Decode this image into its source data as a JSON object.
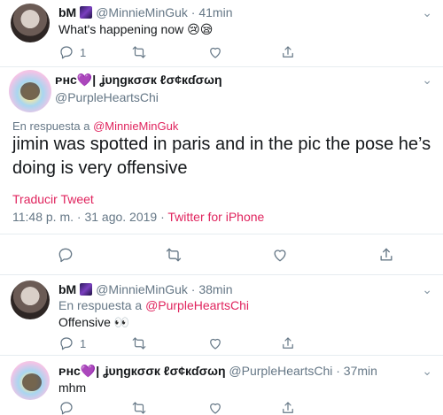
{
  "tweet1": {
    "name": "bM",
    "handle": "@MinnieMinGuk",
    "time": "· 41min",
    "text": "What's happening now 😢😪",
    "reply_count": "1",
    "retweet_count": "",
    "like_count": ""
  },
  "focused": {
    "name": "ᴘнc💜| ʝυηgкσσк ℓσ¢кɗσωη",
    "handle": "@PurpleHeartsChi",
    "replying_prefix": "En respuesta a ",
    "replying_to": "@MinnieMinGuk",
    "text": "jimin was spotted in paris and in the pic the pose he’s doing is very offensive",
    "translate": "Traducir Tweet",
    "timestamp": "11:48 p. m. · 31 ago. 2019",
    "separator": " · ",
    "source": "Twitter for iPhone"
  },
  "tweet3": {
    "name": "bM",
    "handle": "@MinnieMinGuk",
    "time": "· 38min",
    "replying_prefix": "En respuesta a ",
    "replying_to": "@PurpleHeartsChi",
    "text": "Offensive 👀",
    "reply_count": "1"
  },
  "tweet4": {
    "name": "ᴘнc💜| ʝυηgкσσк ℓσ¢кɗσωη",
    "handle": "@PurpleHeartsChi",
    "time": "· 37min",
    "text": "mhm"
  },
  "icons": {
    "caret": "chevron-down-icon",
    "reply": "reply-icon",
    "retweet": "retweet-icon",
    "like": "heart-icon",
    "share": "share-icon"
  },
  "colors": {
    "accent": "#e0245e",
    "muted": "#657786",
    "divider": "#e6ecf0"
  }
}
